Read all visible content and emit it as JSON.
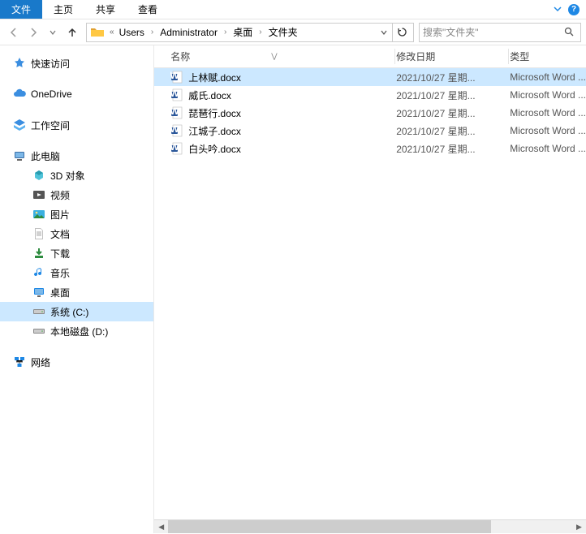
{
  "menubar": {
    "file": "文件",
    "home": "主页",
    "share": "共享",
    "view": "查看"
  },
  "breadcrumb": {
    "segments": [
      "Users",
      "Administrator",
      "桌面",
      "文件夹"
    ]
  },
  "search": {
    "placeholder": "搜索\"文件夹\""
  },
  "nav_tree": {
    "quick_access": "快速访问",
    "onedrive": "OneDrive",
    "workspace": "工作空间",
    "this_pc": "此电脑",
    "children": {
      "objects_3d": "3D 对象",
      "videos": "视频",
      "pictures": "图片",
      "documents": "文档",
      "downloads": "下载",
      "music": "音乐",
      "desktop": "桌面",
      "drive_c": "系统 (C:)",
      "drive_d": "本地磁盘 (D:)"
    },
    "network": "网络"
  },
  "columns": {
    "name": "名称",
    "date_modified": "修改日期",
    "type": "类型"
  },
  "files": [
    {
      "name": "上林赋.docx",
      "date": "2021/10/27 星期...",
      "type": "Microsoft Word ...",
      "selected": true
    },
    {
      "name": "威氏.docx",
      "date": "2021/10/27 星期...",
      "type": "Microsoft Word ...",
      "selected": false
    },
    {
      "name": "琵琶行.docx",
      "date": "2021/10/27 星期...",
      "type": "Microsoft Word ...",
      "selected": false
    },
    {
      "name": "江城子.docx",
      "date": "2021/10/27 星期...",
      "type": "Microsoft Word ...",
      "selected": false
    },
    {
      "name": "白头吟.docx",
      "date": "2021/10/27 星期...",
      "type": "Microsoft Word ...",
      "selected": false
    }
  ]
}
